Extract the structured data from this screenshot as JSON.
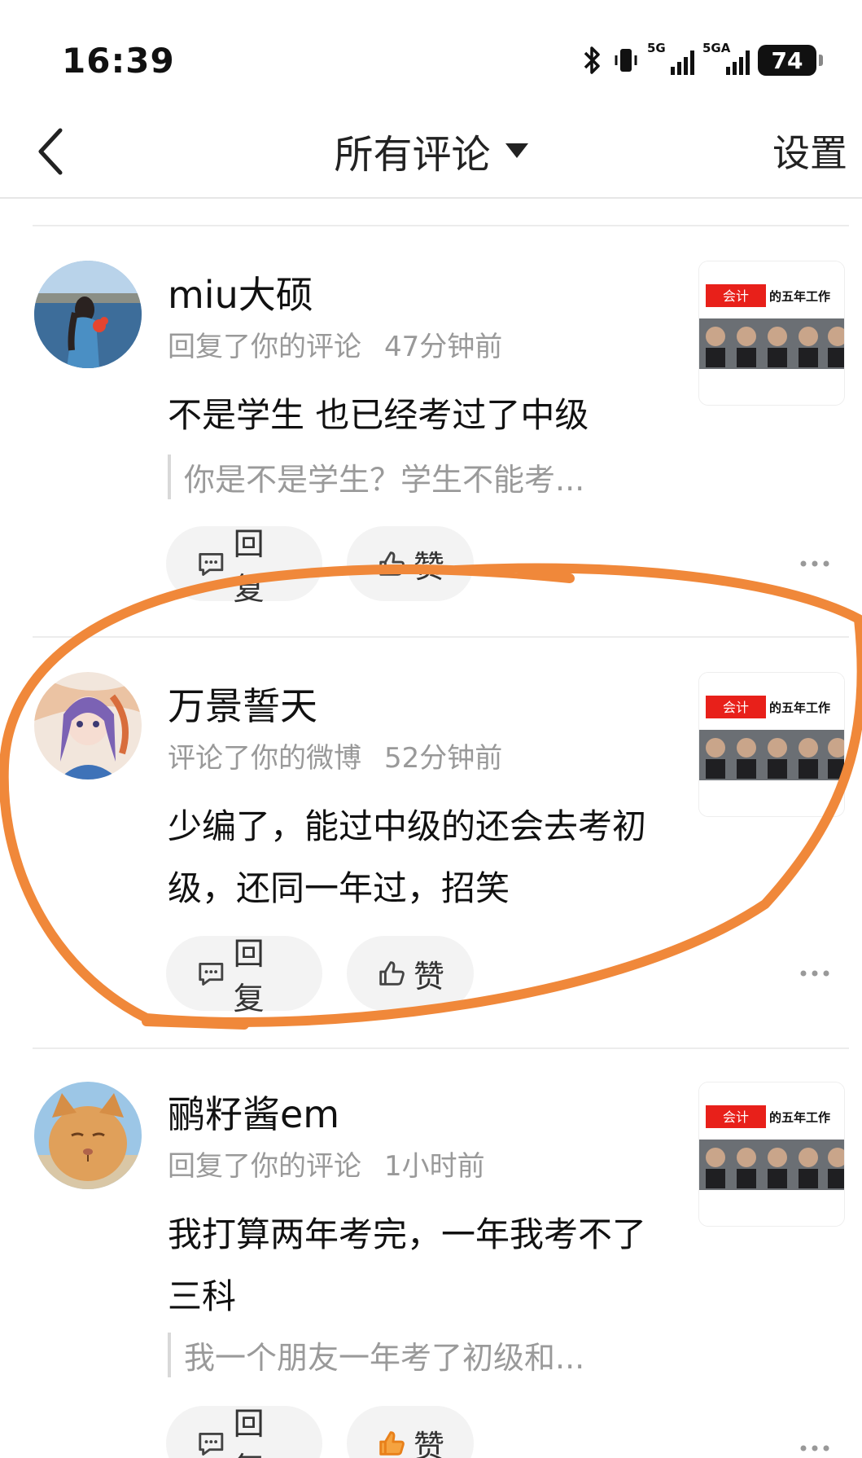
{
  "status_bar": {
    "time": "16:39",
    "signal_1": "5G",
    "signal_2": "5GA",
    "battery": "74"
  },
  "nav": {
    "title": "所有评论",
    "settings": "设置"
  },
  "comments": [
    {
      "username": "miu大硕",
      "action": "回复了你的评论",
      "time": "47分钟前",
      "text": "不是学生 也已经考过了中级",
      "quote": "你是不是学生？学生不能考...",
      "reply_label": "回复",
      "like_label": "赞",
      "thumb_tag": "会计",
      "thumb_title": "的五年工作"
    },
    {
      "username": "万景誓天",
      "action": "评论了你的微博",
      "time": "52分钟前",
      "text": "少编了，能过中级的还会去考初级，还同一年过，招笑",
      "reply_label": "回复",
      "like_label": "赞",
      "thumb_tag": "会计",
      "thumb_title": "的五年工作"
    },
    {
      "username": "鹂籽酱em",
      "action": "回复了你的评论",
      "time": "1小时前",
      "text": "我打算两年考完，一年我考不了三科",
      "quote": "我一个朋友一年考了初级和...",
      "reply_label": "回复",
      "like_label": "赞",
      "thumb_tag": "会计",
      "thumb_title": "的五年工作"
    }
  ],
  "colors": {
    "annotation": "#f0883a",
    "thumb_tag": "#e8201a",
    "meta_text": "#999999"
  }
}
